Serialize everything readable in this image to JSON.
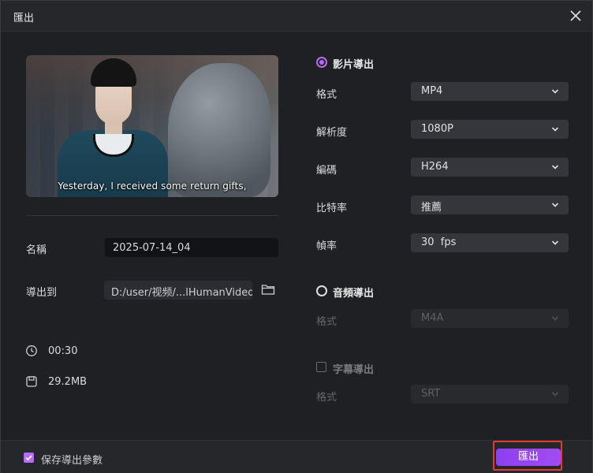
{
  "window": {
    "title": "匯出"
  },
  "preview": {
    "subtitle": "Yesterday, I received some return gifts,"
  },
  "left": {
    "name_label": "名稱",
    "name_value": "2025-07-14_04",
    "export_to_label": "導出到",
    "path_value": "D:/user/视频/...lHumanVideo",
    "duration": "00:30",
    "file_size": "29.2MB"
  },
  "video_export": {
    "heading": "影片導出",
    "selected": true,
    "format_label": "格式",
    "format_value": "MP4",
    "resolution_label": "解析度",
    "resolution_value": "1080P",
    "codec_label": "編碼",
    "codec_value": "H264",
    "bitrate_label": "比特率",
    "bitrate_value": "推薦",
    "framerate_label": "幀率",
    "framerate_value": "30  fps"
  },
  "audio_export": {
    "heading": "音頻導出",
    "selected": false,
    "format_label": "格式",
    "format_value": "M4A"
  },
  "subtitle_export": {
    "heading": "字幕導出",
    "checked": false,
    "format_label": "格式",
    "format_value": "SRT"
  },
  "footer": {
    "save_params_label": "保存導出參數",
    "save_params_checked": true,
    "export_button": "匯出"
  },
  "colors": {
    "accent": "#b76cf5",
    "button": "#9645f1",
    "highlight": "#e53935",
    "background": "#1f2024"
  },
  "icons": {
    "close": "close-icon",
    "folder": "folder-icon",
    "clock": "clock-icon",
    "file": "file-size-icon",
    "chevron": "chevron-down-icon",
    "check": "checkmark-icon"
  }
}
